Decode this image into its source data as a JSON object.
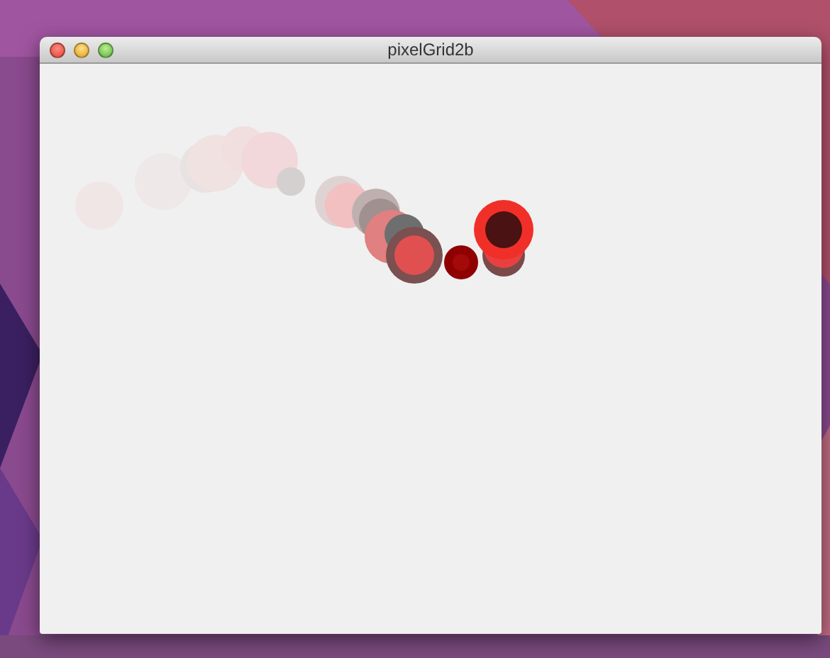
{
  "window": {
    "title": "pixelGrid2b"
  }
}
